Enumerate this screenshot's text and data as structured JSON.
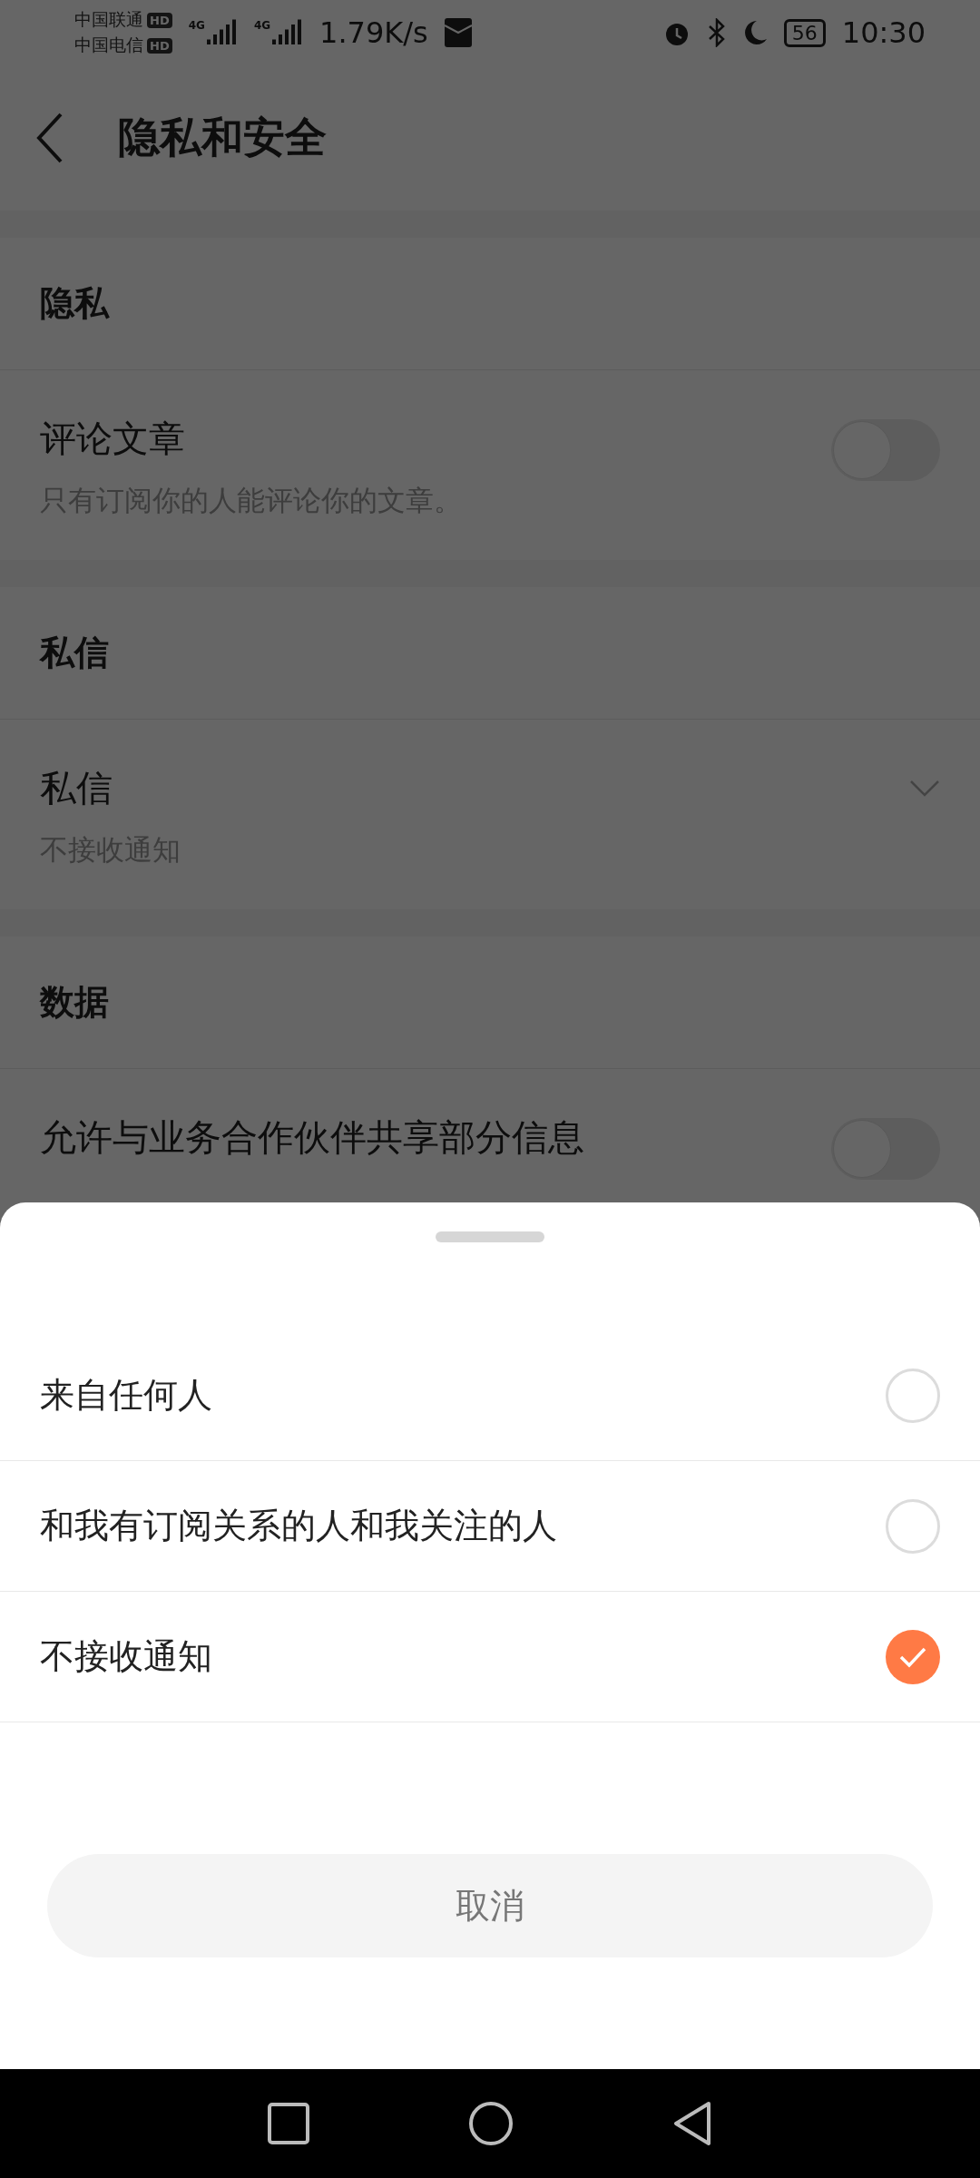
{
  "status_bar": {
    "carriers": [
      {
        "name": "中国联通",
        "badge": "HD"
      },
      {
        "name": "中国电信",
        "badge": "HD"
      }
    ],
    "networks": [
      "4G",
      "4G"
    ],
    "speed": "1.79K/s",
    "battery": "56",
    "time": "10:30"
  },
  "header": {
    "title": "隐私和安全"
  },
  "sections": [
    {
      "title": "隐私",
      "items": [
        {
          "kind": "toggle",
          "title": "评论文章",
          "subtitle": "只有订阅你的人能评论你的文章。",
          "on": false
        }
      ]
    },
    {
      "title": "私信",
      "items": [
        {
          "kind": "select",
          "title": "私信",
          "subtitle": "不接收通知"
        }
      ]
    },
    {
      "title": "数据",
      "items": [
        {
          "kind": "toggle",
          "title": "允许与业务合作伙伴共享部分信息",
          "on": false
        }
      ]
    }
  ],
  "sheet": {
    "options": [
      {
        "label": "来自任何人",
        "selected": false
      },
      {
        "label": "和我有订阅关系的人和我关注的人",
        "selected": false
      },
      {
        "label": "不接收通知",
        "selected": true
      }
    ],
    "cancel": "取消"
  }
}
